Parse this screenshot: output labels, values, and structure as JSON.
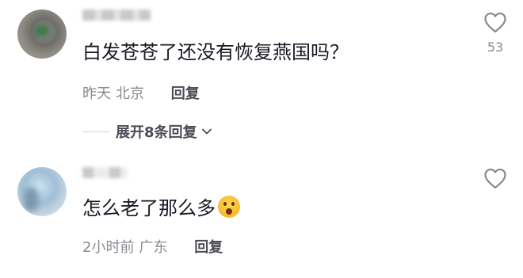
{
  "comments": [
    {
      "text": "白发苍苍了还没有恢复燕国吗？",
      "time": "昨天",
      "location": "北京",
      "reply_label": "回复",
      "like_count": "53",
      "expand_label": "展开8条回复"
    },
    {
      "text": "怎么老了那么多",
      "emoji": "astonished-face",
      "time": "2小时前",
      "location": "广东",
      "reply_label": "回复"
    }
  ],
  "icons": {
    "like": "heart-outline-icon",
    "expand": "chevron-down-icon"
  },
  "colors": {
    "text": "#161823",
    "meta": "#8a8b91",
    "action": "#4b4c54"
  }
}
